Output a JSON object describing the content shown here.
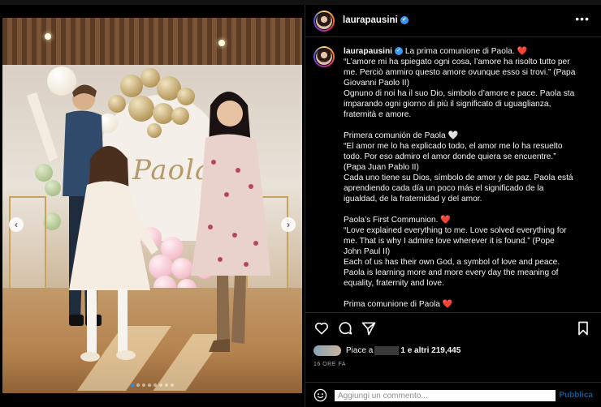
{
  "post": {
    "username": "laurapausini",
    "verified_symbol": "✓",
    "more_symbol": "•••",
    "caption_user": "laurapausini",
    "caption_lines": [
      "La prima comunione di Paola. ❤️",
      "“L’amore mi ha spiegato ogni cosa, l’amore ha risolto tutto per",
      "me. Perciò ammiro questo amore ovunque esso si trovi.” (Papa",
      "Giovanni Paolo II)",
      "Ognuno di noi ha il suo Dio, simbolo d’amore e pace. Paola sta",
      "imparando ogni giorno di più il significato di uguaglianza,",
      "fraternità e amore.",
      "",
      "Primera comunión de Paola 🤍",
      "“El amor me lo ha explicado todo, el amor me lo ha resuelto",
      "todo. Por eso admiro el amor donde quiera se encuentre.”",
      "(Papa Juan Pablo II)",
      "Cada uno tiene su Dios, símbolo de amor y de paz. Paola está",
      "aprendiendo cada día un poco más el significado de la",
      "igualdad, de la fraternidad y del amor.",
      "",
      "Paola’s First Communion. ❤️",
      "“Love explained everything to me. Love solved everything for",
      "me. That is why I admire love wherever it is found.” (Pope",
      "John Paul II)",
      "Each of us has their own God, a symbol of love and peace.",
      "Paola is learning more and more every day the meaning of",
      "equality, fraternity and love.",
      "",
      "Prima comunione di Paola ❤️"
    ],
    "photo_text": "Paola",
    "likes_prefix": "Piace a",
    "likes_suffix": "1 e altri 219,445",
    "timestamp": "16 ORE FA",
    "comment_placeholder": "Aggiungi un commento...",
    "publish_label": "Pubblica",
    "carousel_prev": "‹",
    "carousel_next": "›",
    "carousel_dots": 8,
    "carousel_active_index": 0
  },
  "icons": {
    "like": "heart-icon",
    "comment": "comment-icon",
    "share": "share-icon",
    "save": "bookmark-icon",
    "emoji": "emoji-icon"
  },
  "colors": {
    "background": "#000000",
    "text": "#f5f5f5",
    "verified": "#3897f0",
    "publish": "#0b5a95",
    "muted": "#a8a8a8"
  }
}
